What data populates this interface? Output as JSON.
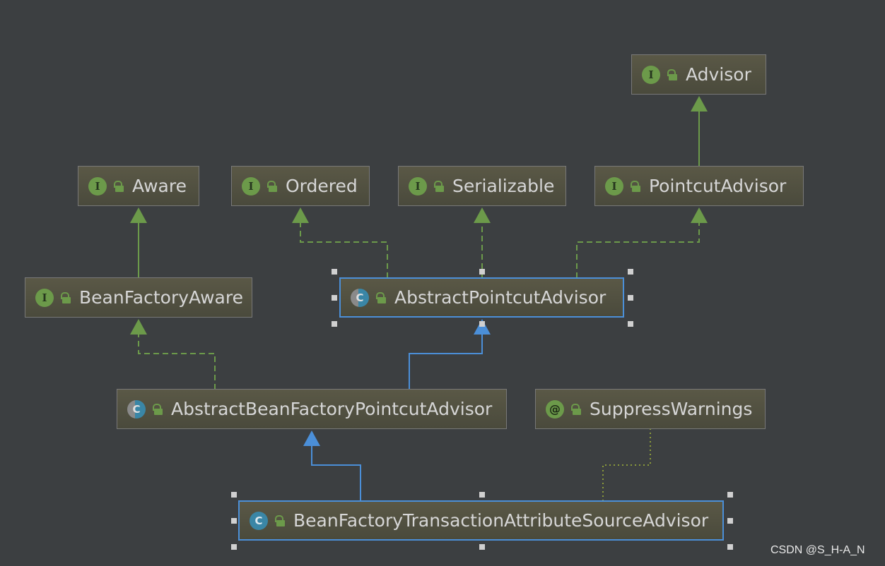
{
  "nodes": {
    "advisor": {
      "kind": "interface",
      "badge": "I",
      "name": "Advisor"
    },
    "aware": {
      "kind": "interface",
      "badge": "I",
      "name": "Aware"
    },
    "ordered": {
      "kind": "interface",
      "badge": "I",
      "name": "Ordered"
    },
    "serializable": {
      "kind": "interface",
      "badge": "I",
      "name": "Serializable"
    },
    "pointcut_advisor": {
      "kind": "interface",
      "badge": "I",
      "name": "PointcutAdvisor"
    },
    "bean_factory_aware": {
      "kind": "interface",
      "badge": "I",
      "name": "BeanFactoryAware"
    },
    "abstract_pointcut_advisor": {
      "kind": "abstract-class",
      "badge": "C",
      "name": "AbstractPointcutAdvisor"
    },
    "abstract_bean_factory_pointcut_advisor": {
      "kind": "abstract-class",
      "badge": "C",
      "name": "AbstractBeanFactoryPointcutAdvisor"
    },
    "suppress_warnings": {
      "kind": "annotation",
      "badge": "@",
      "name": "SuppressWarnings"
    },
    "bean_factory_transaction_attribute_source_advisor": {
      "kind": "class",
      "badge": "C",
      "name": "BeanFactoryTransactionAttributeSourceAdvisor"
    }
  },
  "edges": [
    {
      "from": "PointcutAdvisor",
      "to": "Advisor",
      "type": "extends"
    },
    {
      "from": "BeanFactoryAware",
      "to": "Aware",
      "type": "extends"
    },
    {
      "from": "AbstractPointcutAdvisor",
      "to": "Ordered",
      "type": "implements"
    },
    {
      "from": "AbstractPointcutAdvisor",
      "to": "Serializable",
      "type": "implements"
    },
    {
      "from": "AbstractPointcutAdvisor",
      "to": "PointcutAdvisor",
      "type": "implements"
    },
    {
      "from": "AbstractBeanFactoryPointcutAdvisor",
      "to": "BeanFactoryAware",
      "type": "implements"
    },
    {
      "from": "AbstractBeanFactoryPointcutAdvisor",
      "to": "AbstractPointcutAdvisor",
      "type": "extends-class"
    },
    {
      "from": "BeanFactoryTransactionAttributeSourceAdvisor",
      "to": "AbstractBeanFactoryPointcutAdvisor",
      "type": "extends-class"
    },
    {
      "from": "BeanFactoryTransactionAttributeSourceAdvisor",
      "to": "SuppressWarnings",
      "type": "annotated"
    }
  ],
  "colors": {
    "background": "#3c3f41",
    "interface_edge": "#6c9a4a",
    "class_edge": "#4b8fd8",
    "annotation_edge": "#8a9a3a",
    "node_fill": "#4f4e40",
    "text": "#d6d6d6"
  },
  "watermark": "CSDN @S_H-A_N"
}
